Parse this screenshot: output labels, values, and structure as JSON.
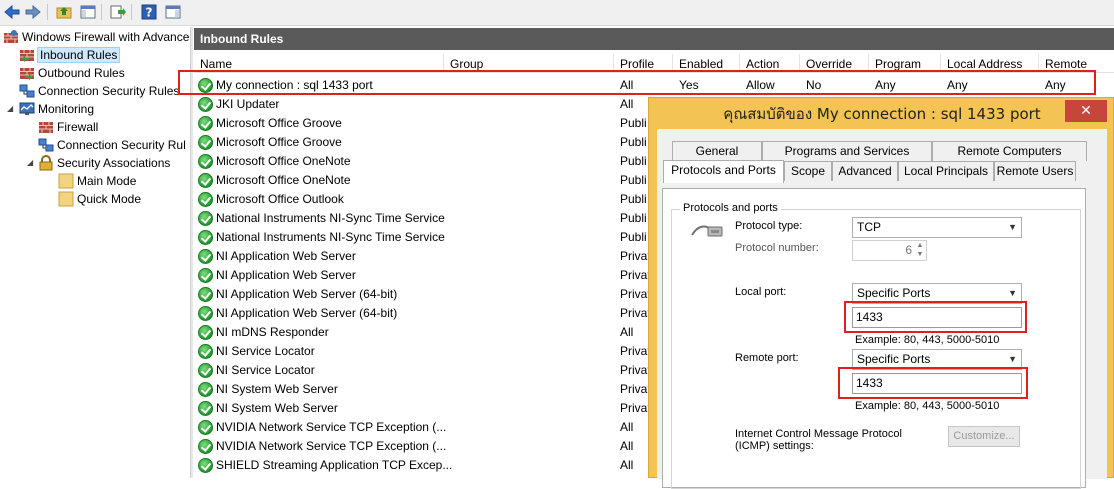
{
  "tree": {
    "root": "Windows Firewall with Advance",
    "items": [
      {
        "label": "Inbound Rules"
      },
      {
        "label": "Outbound Rules"
      },
      {
        "label": "Connection Security Rules"
      },
      {
        "label": "Monitoring"
      },
      {
        "label": "Firewall"
      },
      {
        "label": "Connection Security Rul"
      },
      {
        "label": "Security Associations"
      },
      {
        "label": "Main Mode"
      },
      {
        "label": "Quick Mode"
      }
    ]
  },
  "panel": {
    "title": "Inbound Rules",
    "columns": [
      "Name",
      "Group",
      "Profile",
      "Enabled",
      "Action",
      "Override",
      "Program",
      "Local Address",
      "Remote"
    ]
  },
  "rows": [
    {
      "name": "My connection : sql 1433 port",
      "profile": "All",
      "enabled": "Yes",
      "action": "Allow",
      "override": "No",
      "program": "Any",
      "local": "Any",
      "remote": "Any"
    },
    {
      "name": "JKI Updater",
      "profile": "All"
    },
    {
      "name": "Microsoft Office Groove",
      "profile": "Publi"
    },
    {
      "name": "Microsoft Office Groove",
      "profile": "Publi"
    },
    {
      "name": "Microsoft Office OneNote",
      "profile": "Publi"
    },
    {
      "name": "Microsoft Office OneNote",
      "profile": "Publi"
    },
    {
      "name": "Microsoft Office Outlook",
      "profile": "Publi"
    },
    {
      "name": "National Instruments NI-Sync Time Service",
      "profile": "Publi"
    },
    {
      "name": "National Instruments NI-Sync Time Service",
      "profile": "Publi"
    },
    {
      "name": "NI Application Web Server",
      "profile": "Privat"
    },
    {
      "name": "NI Application Web Server",
      "profile": "Privat"
    },
    {
      "name": "NI Application Web Server (64-bit)",
      "profile": "Privat"
    },
    {
      "name": "NI Application Web Server (64-bit)",
      "profile": "Privat"
    },
    {
      "name": "NI mDNS Responder",
      "profile": "All"
    },
    {
      "name": "NI Service Locator",
      "profile": "Privat"
    },
    {
      "name": "NI Service Locator",
      "profile": "Privat"
    },
    {
      "name": "NI System Web Server",
      "profile": "Privat"
    },
    {
      "name": "NI System Web Server",
      "profile": "Privat"
    },
    {
      "name": "NVIDIA Network Service TCP Exception (...",
      "profile": "All"
    },
    {
      "name": "NVIDIA Network Service TCP Exception (...",
      "profile": "All"
    },
    {
      "name": "SHIELD Streaming Application TCP Excep...",
      "profile": "All"
    }
  ],
  "dialog": {
    "title": "คุณสมบัติของ My connection : sql 1433 port",
    "close": "✕",
    "tabs_top": [
      "General",
      "Programs and Services",
      "Remote Computers"
    ],
    "tabs_bottom": [
      "Protocols and Ports",
      "Scope",
      "Advanced",
      "Local Principals",
      "Remote Users"
    ],
    "group_label": "Protocols and ports",
    "protocol_type_label": "Protocol type:",
    "protocol_type_value": "TCP",
    "protocol_number_label": "Protocol number:",
    "protocol_number_value": "6",
    "local_port_label": "Local port:",
    "local_port_mode": "Specific Ports",
    "local_port_value": "1433",
    "local_example": "Example: 80, 443, 5000-5010",
    "remote_port_label": "Remote port:",
    "remote_port_mode": "Specific Ports",
    "remote_port_value": "1433",
    "remote_example": "Example: 80, 443, 5000-5010",
    "icmp_label_1": "Internet Control Message Protocol",
    "icmp_label_2": "(ICMP) settings:",
    "customize_button": "Customize..."
  },
  "colors": {
    "header_bg": "#5a5a5a",
    "dialog_frame": "#f3c453",
    "close_button": "#c7463b",
    "highlight": "#e02020",
    "enabled_icon": "#1e9a2c"
  }
}
